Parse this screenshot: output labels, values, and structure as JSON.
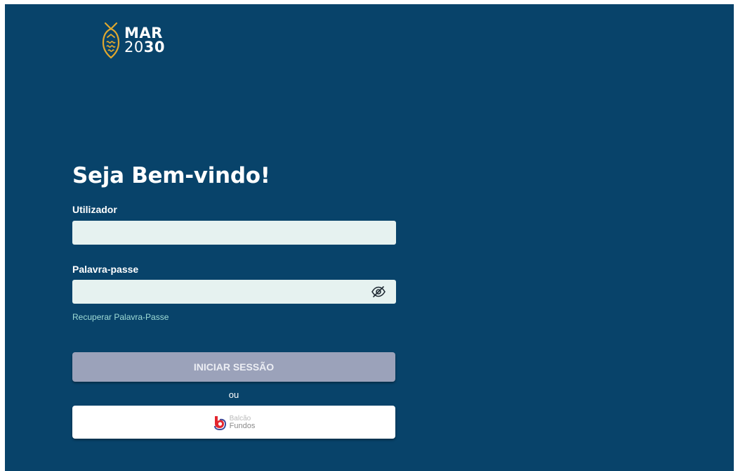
{
  "brand": {
    "line1": "MAR",
    "line2_light": "20",
    "line2_bold": "30",
    "accent_color": "#e0a82e"
  },
  "login": {
    "title": "Seja Bem-vindo!",
    "username_label": "Utilizador",
    "username_value": "",
    "password_label": "Palavra-passe",
    "password_value": "",
    "toggle_icon": "eye-slash-icon",
    "recover_link": "Recuperar Palavra-Passe",
    "submit_label": "INICIAR SESSÃO",
    "separator": "ou",
    "alt_login": {
      "line1": "Balcão",
      "line2": "Fundos",
      "logo_color": "#e3262f"
    }
  },
  "colors": {
    "background": "#08436a",
    "field": "#e6f2f0",
    "submit": "#9ba2ba",
    "link": "#9fdcd6"
  }
}
